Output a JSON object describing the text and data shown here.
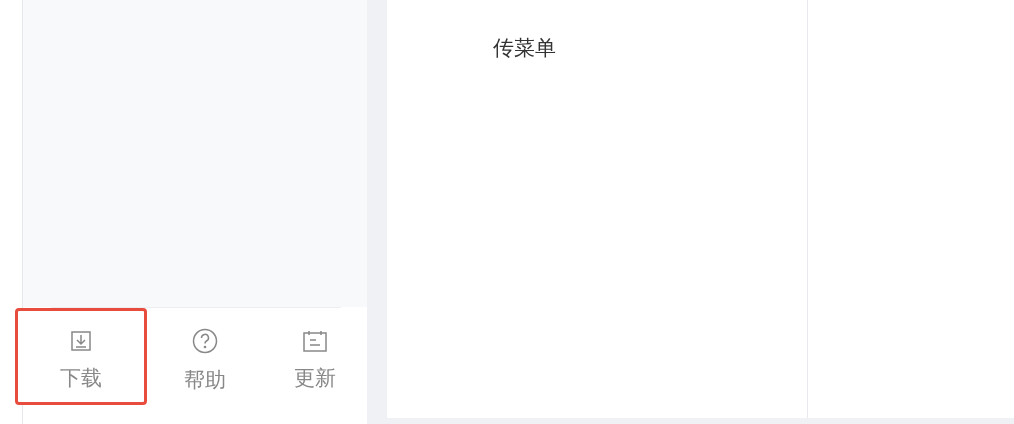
{
  "content": {
    "item": "传菜单"
  },
  "footer_buttons": [
    {
      "label": "下载",
      "kind": "download",
      "selected": true
    },
    {
      "label": "帮助",
      "kind": "help",
      "selected": false
    },
    {
      "label": "更新",
      "kind": "update",
      "selected": false
    }
  ]
}
